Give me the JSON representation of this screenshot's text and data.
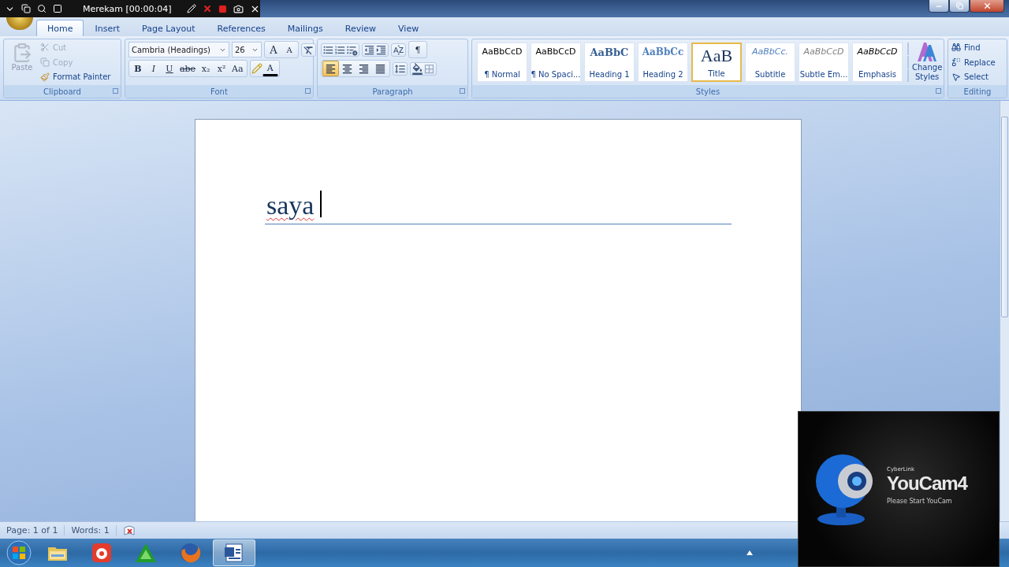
{
  "recorder": {
    "status": "Merekam [00:00:04]"
  },
  "tabs": [
    {
      "label": "Home",
      "selected": true
    },
    {
      "label": "Insert",
      "selected": false
    },
    {
      "label": "Page Layout",
      "selected": false
    },
    {
      "label": "References",
      "selected": false
    },
    {
      "label": "Mailings",
      "selected": false
    },
    {
      "label": "Review",
      "selected": false
    },
    {
      "label": "View",
      "selected": false
    }
  ],
  "clipboard": {
    "paste": "Paste",
    "cut": "Cut",
    "copy": "Copy",
    "format_painter": "Format Painter",
    "label": "Clipboard"
  },
  "font": {
    "name": "Cambria (Headings)",
    "size": "26",
    "grow": "A",
    "shrink": "A",
    "bold": "B",
    "italic": "I",
    "underline": "U",
    "strike": "abe",
    "subscript": "x₂",
    "superscript": "x²",
    "case": "Aa",
    "color_label": "A",
    "label": "Font"
  },
  "paragraph": {
    "label": "Paragraph",
    "pilcrow": "¶",
    "align": [
      {
        "kind": "left",
        "selected": true
      },
      {
        "kind": "center",
        "selected": false
      },
      {
        "kind": "right",
        "selected": false
      },
      {
        "kind": "justify",
        "selected": false
      }
    ]
  },
  "styles": {
    "label": "Styles",
    "items": [
      {
        "kind": "normal",
        "preview": "AaBbCcD",
        "name": "¶ Normal",
        "selected": false
      },
      {
        "kind": "normal",
        "preview": "AaBbCcD",
        "name": "¶ No Spaci...",
        "selected": false
      },
      {
        "kind": "heading1",
        "preview": "AaBbC",
        "name": "Heading 1",
        "selected": false
      },
      {
        "kind": "heading2",
        "preview": "AaBbCc",
        "name": "Heading 2",
        "selected": false
      },
      {
        "kind": "title",
        "preview": "AaB",
        "name": "Title",
        "selected": true
      },
      {
        "kind": "subtitle",
        "preview": "AaBbCc.",
        "name": "Subtitle",
        "selected": false
      },
      {
        "kind": "subtle",
        "preview": "AaBbCcD",
        "name": "Subtle Em...",
        "selected": false
      },
      {
        "kind": "emphasis",
        "preview": "AaBbCcD",
        "name": "Emphasis",
        "selected": false
      }
    ],
    "change_styles": "Change Styles"
  },
  "editing": {
    "label": "Editing",
    "find": "Find",
    "replace": "Replace",
    "select": "Select"
  },
  "document": {
    "text": "saya",
    "misspelled": true
  },
  "status_bar": {
    "page": "Page: 1 of 1",
    "words": "Words: 1"
  },
  "taskbar": {
    "apps": [
      {
        "kind": "explorer",
        "selected": false
      },
      {
        "kind": "player",
        "selected": false
      },
      {
        "kind": "triangle",
        "selected": false
      },
      {
        "kind": "firefox",
        "selected": false
      },
      {
        "kind": "word",
        "selected": true
      }
    ]
  },
  "webcam_overlay": {
    "brand": "CyberLink",
    "product": "YouCam4",
    "message": "Please Start YouCam"
  }
}
